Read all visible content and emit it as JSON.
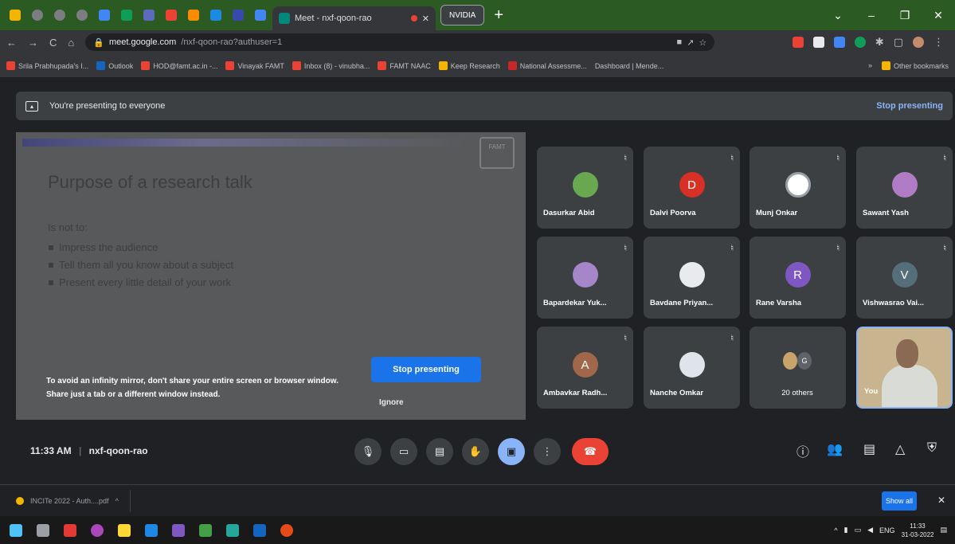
{
  "browser": {
    "tab_title": "Meet - nxf-qoon-rao",
    "nvidia_tab": "NVIDIA",
    "url_host": "meet.google.com",
    "url_path": "/nxf-qoon-rao?authuser=1"
  },
  "bookmarks": {
    "items": [
      "Srila Prabhupada's I...",
      "Outlook",
      "HOD@famt.ac.in -...",
      "Vinayak FAMT",
      "Inbox (8) - vinubha...",
      "FAMT NAAC",
      "Keep Research",
      "National Assessme...",
      "Dashboard | Mende..."
    ],
    "other": "Other bookmarks"
  },
  "banner": {
    "text": "You're presenting to everyone",
    "stop": "Stop presenting"
  },
  "slide": {
    "logo": "FAMT",
    "title": "Purpose of a research talk",
    "subtitle": "Is not to:",
    "bullets": [
      "Impress the audience",
      "Tell them all you know about a subject",
      "Present every little detail of your work"
    ],
    "warning": "To avoid an infinity mirror, don't share your entire screen or browser window. Share just a tab or a different window instead.",
    "stop_button": "Stop presenting",
    "ignore": "Ignore"
  },
  "participants": [
    {
      "name": "Dasurkar Abid",
      "initial": "",
      "color": "#6aa84f"
    },
    {
      "name": "Dalvi Poorva",
      "initial": "D",
      "color": "#d93025"
    },
    {
      "name": "Munj Onkar",
      "initial": "",
      "color": "#ffffff"
    },
    {
      "name": "Sawant Yash",
      "initial": "",
      "color": "#b07cc6"
    },
    {
      "name": "Bapardekar Yuk...",
      "initial": "",
      "color": "#a586c9"
    },
    {
      "name": "Bavdane Priyan...",
      "initial": "",
      "color": "#e8eaed"
    },
    {
      "name": "Rane Varsha",
      "initial": "R",
      "color": "#7e57c2"
    },
    {
      "name": "Vishwasrao Vai...",
      "initial": "V",
      "color": "#546e7a"
    },
    {
      "name": "Ambavkar Radh...",
      "initial": "A",
      "color": "#a1674a"
    },
    {
      "name": "Nanche Omkar",
      "initial": "",
      "color": "#dfe4ea"
    }
  ],
  "others_label": "20 others",
  "others_initial": "G",
  "self_label": "You",
  "meeting": {
    "time": "11:33 AM",
    "code": "nxf-qoon-rao"
  },
  "download": {
    "file": "INCITe 2022 - Auth....pdf",
    "show_all": "Show all"
  },
  "taskbar": {
    "lang": "ENG",
    "time": "11:33",
    "date": "31-03-2022"
  }
}
